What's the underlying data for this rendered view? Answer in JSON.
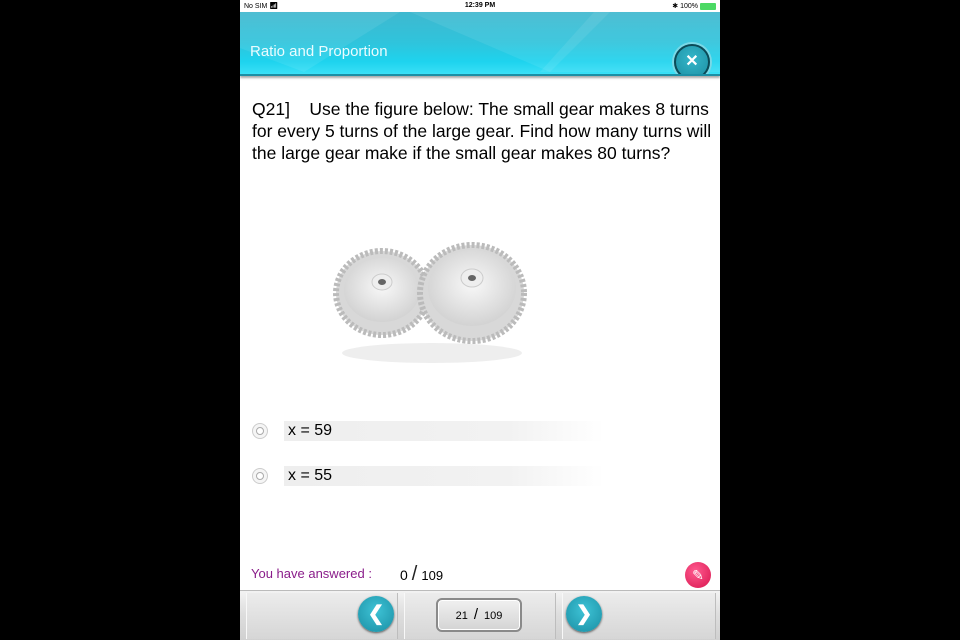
{
  "status_bar": {
    "carrier": "No SIM",
    "wifi_icon": "wifi-icon",
    "time": "12:39 PM",
    "bluetooth_icon": "bluetooth-icon",
    "battery": "100%"
  },
  "header": {
    "title": "Ratio and Proportion",
    "close_icon": "close-icon"
  },
  "question": {
    "text": "Q21]    Use the figure below: The small gear makes 8 turns for every 5 turns of the large gear. Find how many turns will the large gear make if the small gear makes 80 turns?",
    "image": "two-gears-image"
  },
  "options": [
    {
      "label": "x = 59",
      "selected": false
    },
    {
      "label": "x = 55",
      "selected": false
    }
  ],
  "progress": {
    "label": "You have answered :",
    "answered": "0",
    "separator": "/",
    "total": "109"
  },
  "footer": {
    "prev_icon": "chevron-left-icon",
    "next_icon": "chevron-right-icon",
    "current_page": "21",
    "separator": "/",
    "total_pages": "109",
    "pencil_icon": "pencil-icon"
  },
  "colors": {
    "accent": "#2fc4dc",
    "answered_text": "#8a1d8a",
    "pencil_button": "#e0245e"
  }
}
